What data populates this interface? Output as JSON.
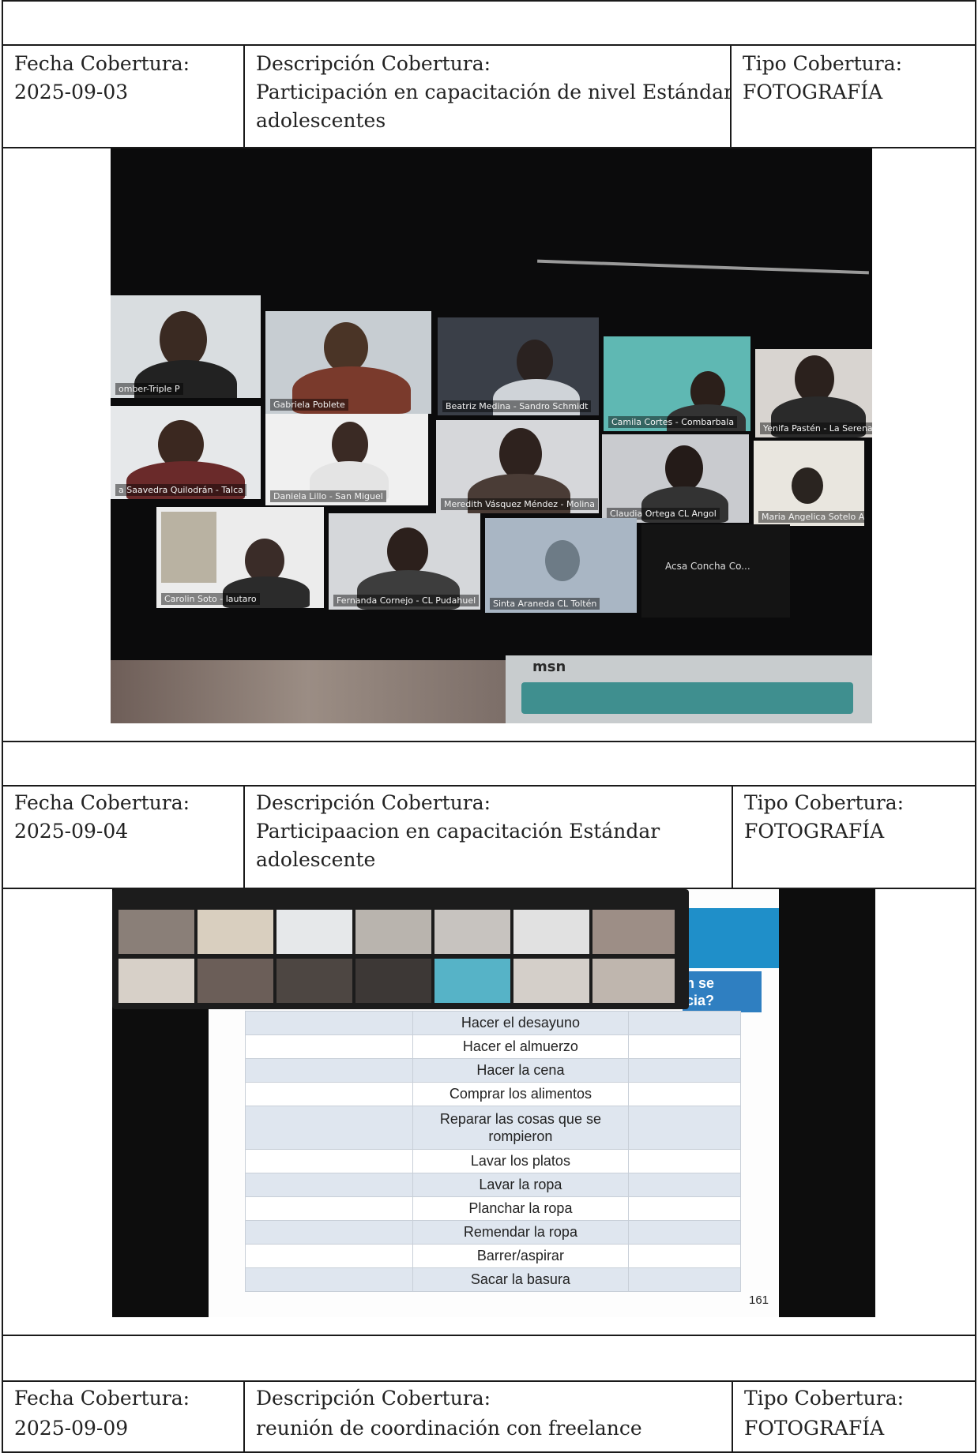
{
  "labels": {
    "date_label": "Fecha Cobertura:",
    "description_label": "Descripción Cobertura:",
    "type_label": "Tipo Cobertura:"
  },
  "entries": [
    {
      "date": "2025-09-03",
      "description": [
        "Participación en capacitación de nivel Estándar",
        "adolescentes"
      ],
      "type": "FOTOGRAFÍA"
    },
    {
      "date": "2025-09-04",
      "description": [
        "Participaacion en capacitación Estándar",
        "adolescente"
      ],
      "type": "FOTOGRAFÍA"
    },
    {
      "date": "2025-09-09",
      "description": [
        "reunión de coordinación con freelance"
      ],
      "type": "FOTOGRAFÍA"
    }
  ],
  "photo1": {
    "participants": [
      "omber-Triple P",
      "Gabriela Poblete",
      "Beatriz Medina - Sandro Schmidt",
      "Camila Cortes - Combarbala",
      "Yenifa Pastén - La Serena",
      "a Saavedra Quilodrán - Talca",
      "Daniela Lillo - San Miguel",
      "Meredith Vásquez Méndez - Molina",
      "Claudia Ortega CL Angol",
      "Maria Angelica Sotelo Atria",
      "Carolin Soto - lautaro",
      "Fernanda Cornejo - CL Pudahuel",
      "Sinta Araneda CL Toltén",
      "Acsa Concha Co..."
    ],
    "browser_brand": "msn"
  },
  "photo2": {
    "question_fragment": [
      "n se",
      "cia?"
    ],
    "chores": [
      "Hacer el desayuno",
      "Hacer el almuerzo",
      "Hacer la cena",
      "Comprar los alimentos",
      "Reparar las cosas que se rompieron",
      "Lavar los platos",
      "Lavar la ropa",
      "Planchar la ropa",
      "Remendar la ropa",
      "Barrer/aspirar",
      "Sacar la basura"
    ],
    "slide_number": "161"
  }
}
